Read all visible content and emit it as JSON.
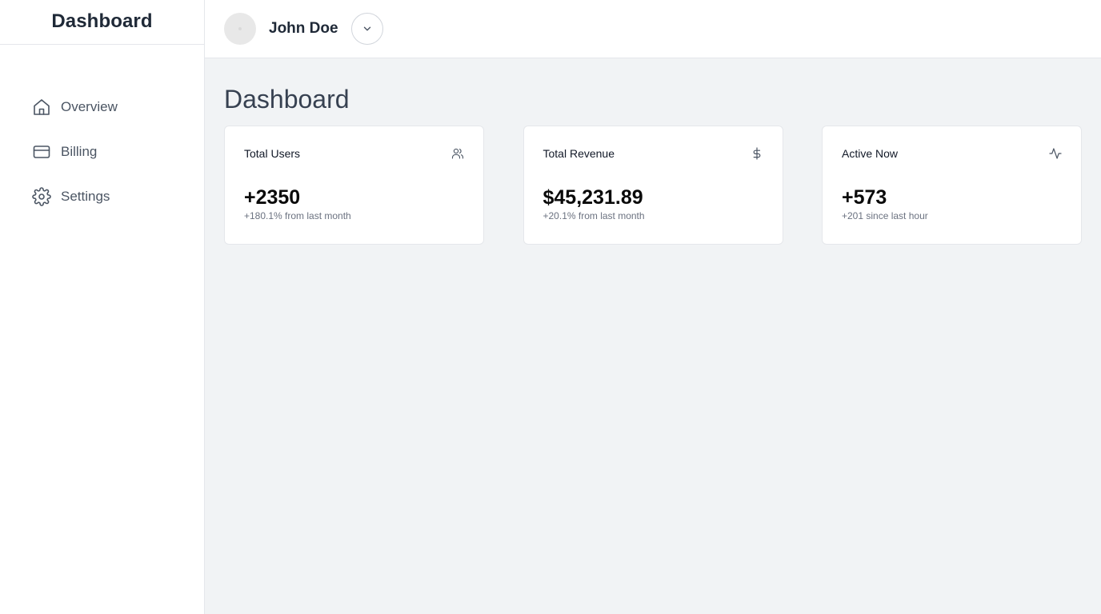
{
  "sidebar": {
    "brand": "Dashboard",
    "items": [
      {
        "label": "Overview",
        "icon": "home-icon"
      },
      {
        "label": "Billing",
        "icon": "credit-card-icon"
      },
      {
        "label": "Settings",
        "icon": "gear-icon"
      }
    ]
  },
  "header": {
    "user_name": "John Doe",
    "menu_icon": "chevron-down-icon"
  },
  "main": {
    "title": "Dashboard",
    "cards": [
      {
        "title": "Total Users",
        "value": "+2350",
        "sub": "+180.1% from last month",
        "icon": "users-icon"
      },
      {
        "title": "Total Revenue",
        "value": "$45,231.89",
        "sub": "+20.1% from last month",
        "icon": "dollar-icon"
      },
      {
        "title": "Active Now",
        "value": "+573",
        "sub": "+201 since last hour",
        "icon": "activity-icon"
      }
    ]
  },
  "colors": {
    "background": "#f1f3f5",
    "surface": "#ffffff",
    "border": "#e5e7eb",
    "text_primary": "#1f2937",
    "text_muted": "#6b7280"
  }
}
